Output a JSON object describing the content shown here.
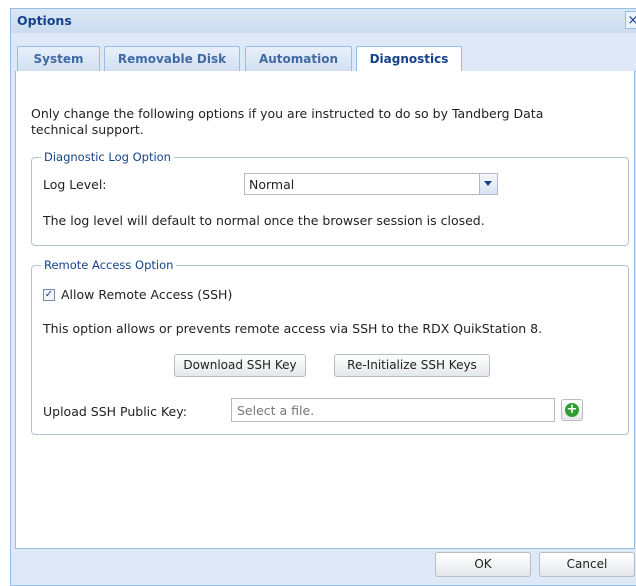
{
  "window": {
    "title": "Options",
    "close_glyph": "×"
  },
  "tabs": [
    {
      "label": "System"
    },
    {
      "label": "Removable Disk"
    },
    {
      "label": "Automation"
    },
    {
      "label": "Diagnostics",
      "active": true
    }
  ],
  "diagnostics": {
    "intro_line1": "Only change the following options if you are instructed to do so by Tandberg Data",
    "intro_line2": "technical support.",
    "log_option": {
      "legend": "Diagnostic Log Option",
      "log_level_label": "Log Level:",
      "log_level_value": "Normal",
      "note": "The log level will default to normal once the browser session is closed."
    },
    "remote_access": {
      "legend": "Remote Access Option",
      "allow_label": "Allow Remote Access (SSH)",
      "allow_checked": true,
      "check_glyph": "✓",
      "description": "This option allows or prevents remote access via SSH to the RDX QuikStation 8.",
      "download_key_label": "Download SSH Key",
      "reinit_keys_label": "Re-Initialize SSH Keys",
      "upload_label": "Upload SSH Public Key:",
      "upload_placeholder": "Select a file.",
      "add_glyph": "+"
    }
  },
  "footer": {
    "ok_label": "OK",
    "cancel_label": "Cancel"
  },
  "colors": {
    "accent": "#15428b",
    "frame": "#dfe8f6",
    "border": "#99bbe8",
    "add_green": "#2f9e2f"
  }
}
